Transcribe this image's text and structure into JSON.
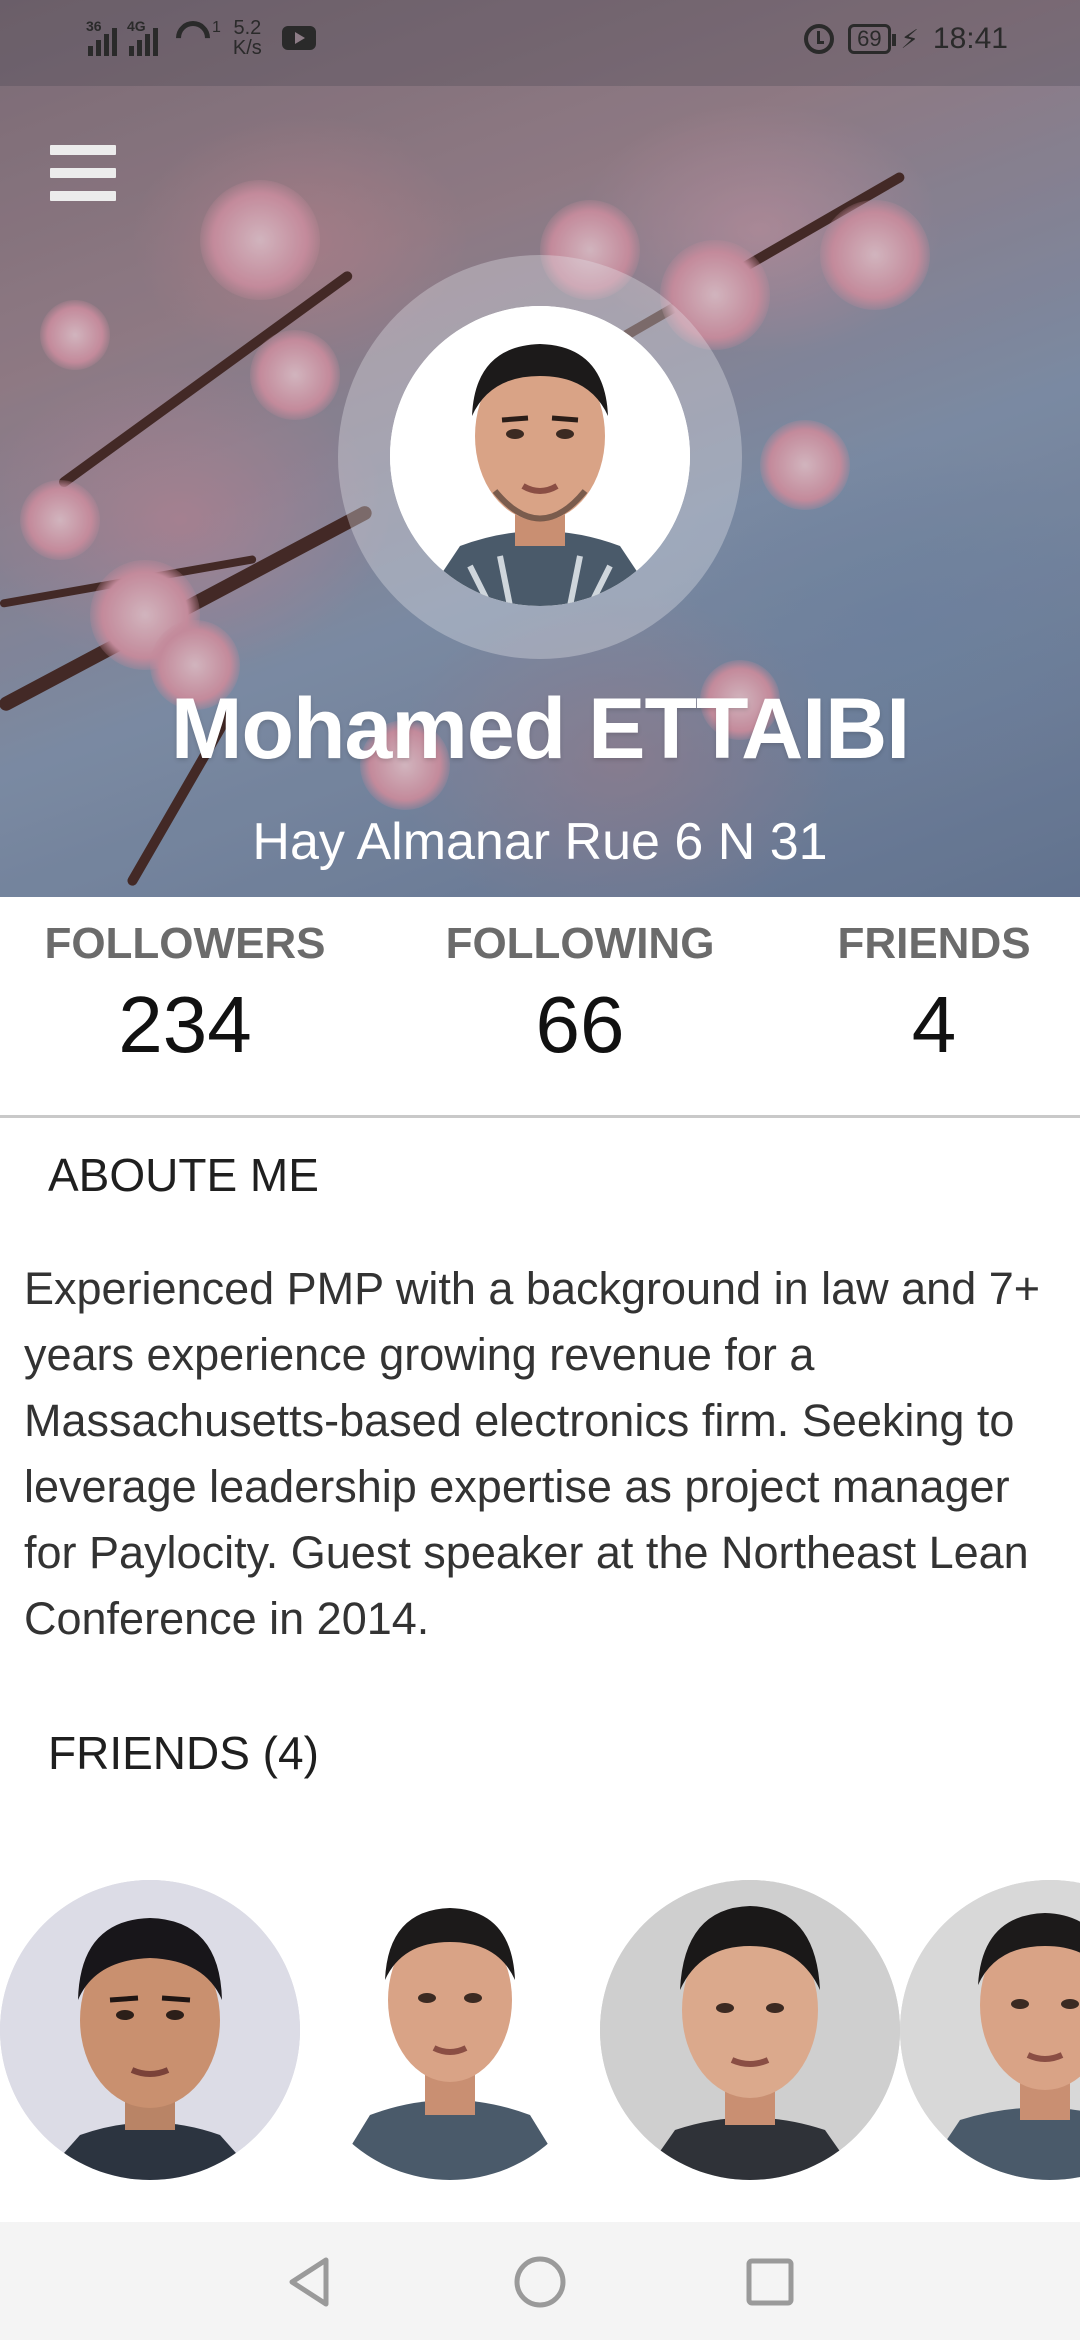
{
  "status_bar": {
    "net1": "36",
    "net2": "4G",
    "hotspot_count": "1",
    "speed_value": "5.2",
    "speed_unit": "K/s",
    "battery": "69",
    "time": "18:41"
  },
  "profile": {
    "name": "Mohamed ETTAIBI",
    "address": "Hay Almanar Rue 6 N 31"
  },
  "stats": [
    {
      "label": "FOLLOWERS",
      "value": "234"
    },
    {
      "label": "FOLLOWING",
      "value": "66"
    },
    {
      "label": "FRIENDS",
      "value": "4"
    }
  ],
  "about": {
    "title": "ABOUTE ME",
    "text": "Experienced PMP with a background in law and 7+ years experience growing revenue for a Massachusetts-based electronics firm. Seeking to leverage leadership expertise as project manager for Paylocity. Guest speaker at the Northeast Lean Conference in 2014."
  },
  "friends": {
    "title": "FRIENDS (4)"
  },
  "icons": {
    "menu": "hamburger-menu-icon",
    "back": "back-triangle-icon",
    "home": "home-circle-icon",
    "recent": "recent-apps-square-icon"
  },
  "colors": {
    "stat_label": "#6b6b6b",
    "stat_value": "#111111",
    "body_text": "#333333"
  }
}
